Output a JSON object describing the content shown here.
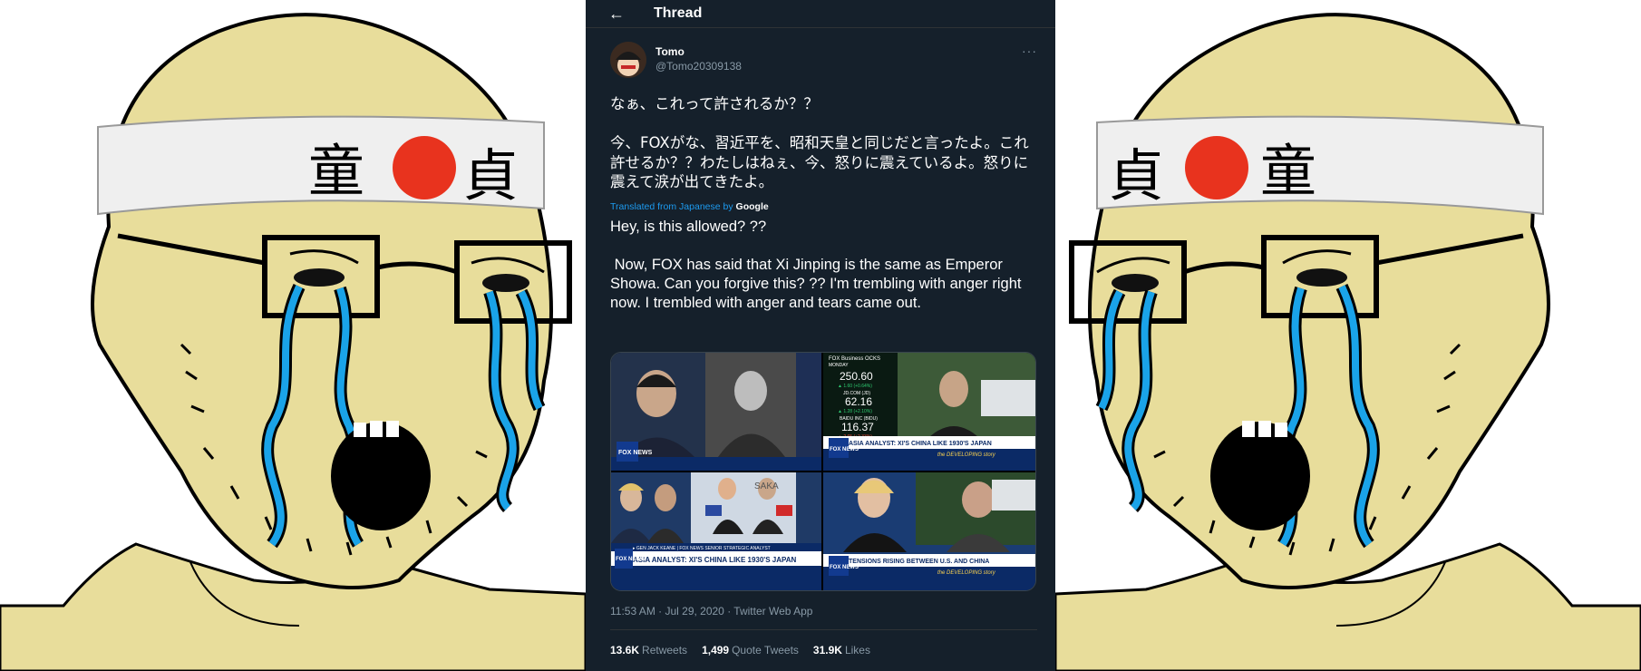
{
  "thread": {
    "back_icon": "back-arrow-icon",
    "title": "Thread"
  },
  "author": {
    "name": "Tomo",
    "handle": "@Tomo20309138",
    "more_icon": "more-options-icon",
    "more_label": "···"
  },
  "tweet": {
    "original_text": "なぁ、これって許されるか？？\n\n今、FOXがな、習近平を、昭和天皇と同じだと言ったよ。これ許せるか？？わたしはねぇ、今、怒りに震えているよ。怒りに震えて涙が出てきたよ。",
    "translated_prefix": "Translated from Japanese by",
    "translated_service": "Google",
    "translated_text": "Hey, is this allowed? ??\n\n Now, FOX has said that Xi Jinping is the same as Emperor Showa. Can you forgive this? ?? I'm trembling with anger right now. I trembled with anger and tears came out."
  },
  "media": {
    "panel_tr_header": "FOX Business  OCKS",
    "panel_tr_sub": "MONDAY",
    "panel_tr_ticker1": "250.60",
    "panel_tr_ticker1_change": "▲ 1.60  (+0.64%)",
    "panel_tr_name2": "JD.COM  (JD)",
    "panel_tr_ticker2": "62.16",
    "panel_tr_ticker2_change": "▲ 1.28  (+2.10%)",
    "panel_tr_name3": "BAIDU INC  (BIDU)",
    "panel_tr_ticker3": "116.37",
    "panel_tr_ticker3_change": "▲ 2.65  (+2.33%)",
    "fox_logo": "FOX NEWS",
    "headline_top": "ASIA ANALYST: XI'S CHINA LIKE 1930'S JAPAN",
    "subline_top": "the DEVELOPING story",
    "sign_text": "SAKA",
    "guest_label": "▸ GEN JACK KEANE  |  FOX NEWS SENIOR STRATEGIC ANALYST",
    "headline_bl": "ASIA ANALYST: XI'S CHINA LIKE 1930'S JAPAN",
    "headline_br": "TENSIONS RISING BETWEEN U.S. AND CHINA",
    "subline_br": "the DEVELOPING story"
  },
  "meta": {
    "timestamp": "11:53 AM · Jul 29, 2020 · Twitter Web App"
  },
  "stats": {
    "retweets_count": "13.6K",
    "retweets_label": "Retweets",
    "quotes_count": "1,499",
    "quotes_label": "Quote Tweets",
    "likes_count": "31.9K",
    "likes_label": "Likes"
  },
  "wojak": {
    "headband_left": [
      "童",
      "貞"
    ],
    "headband_right": [
      "貞",
      "童"
    ]
  },
  "colors": {
    "tweet_bg": "#15202b",
    "link_blue": "#1d9bf0",
    "muted": "#8899a6",
    "skin": "#e8dd9b",
    "tears": "#1aa3e8",
    "rising_sun": "#e8331e"
  }
}
